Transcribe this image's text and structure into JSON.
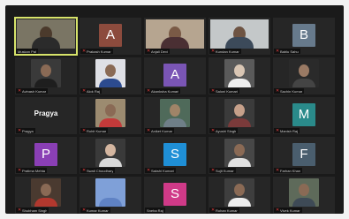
{
  "participants": [
    {
      "name": "Muskan Pal",
      "kind": "video",
      "bg": "#7a7564",
      "skin": "#4b3a2c",
      "shirt": "#2b2b2b",
      "active": true,
      "muted": false
    },
    {
      "name": "Prakash Kumar",
      "kind": "letter",
      "letter": "A",
      "color": "#8c4b3d",
      "muted": true
    },
    {
      "name": "Anjali Devi",
      "kind": "video",
      "bg": "#b6a590",
      "skin": "#7a5a46",
      "shirt": "#4a2f33",
      "active": false,
      "muted": true
    },
    {
      "name": "Kundan Kumar",
      "kind": "video",
      "bg": "#c4c8c9",
      "skin": "#6e5443",
      "shirt": "#3c4a5a",
      "active": false,
      "muted": true
    },
    {
      "name": "Bablu Sahu",
      "kind": "letter",
      "letter": "B",
      "color": "#677a8c",
      "muted": true
    },
    {
      "name": "Avinash Kumar",
      "kind": "photo",
      "bg": "#3a3a3a",
      "skin": "#8a6a55",
      "shirt": "#1e1e1e",
      "muted": true
    },
    {
      "name": "Alok Raj",
      "kind": "photo",
      "bg": "#dfe0e6",
      "skin": "#8a6a55",
      "shirt": "#2c4b8f",
      "muted": true
    },
    {
      "name": "Akanksha Kumari",
      "kind": "letter",
      "letter": "A",
      "color": "#7a55b5",
      "muted": true
    },
    {
      "name": "Saloni Kumari",
      "kind": "photo",
      "bg": "#5a5a5a",
      "skin": "#d9c6b4",
      "shirt": "#efefef",
      "muted": true
    },
    {
      "name": "Sachin Kumar",
      "kind": "photo",
      "bg": "#2a2a2a",
      "skin": "#9a7a64",
      "shirt": "#444444",
      "muted": true
    },
    {
      "name": "Pragya",
      "kind": "name",
      "muted": true
    },
    {
      "name": "Rohit Kumar",
      "kind": "photo",
      "bg": "#9c8b70",
      "skin": "#8a6a55",
      "shirt": "#c33a3a",
      "muted": true
    },
    {
      "name": "Aniket Kumar",
      "kind": "photo",
      "bg": "#4f6a5a",
      "skin": "#a08468",
      "shirt": "#6f7f88",
      "muted": true
    },
    {
      "name": "Ayushi Singh",
      "kind": "photo",
      "bg": "#3b3b3b",
      "skin": "#c6a08a",
      "shirt": "#7a3a3a",
      "muted": true
    },
    {
      "name": "Manish Raj",
      "kind": "letter",
      "letter": "M",
      "color": "#2a8a8a",
      "muted": true
    },
    {
      "name": "Pratima Mehta",
      "kind": "letter",
      "letter": "P",
      "color": "#8a3fb5",
      "muted": true
    },
    {
      "name": "Swati Choudhary",
      "kind": "photo",
      "bg": "#3a3a3a",
      "skin": "#d4b6a0",
      "shirt": "#d9d9d9",
      "muted": true
    },
    {
      "name": "Sakshi Kumari",
      "kind": "letter",
      "letter": "S",
      "color": "#1f8fd6",
      "muted": true
    },
    {
      "name": "Sujit Kumar",
      "kind": "photo",
      "bg": "#474747",
      "skin": "#8a6a55",
      "shirt": "#e0e0e0",
      "muted": true
    },
    {
      "name": "Farhan Khan",
      "kind": "letter",
      "letter": "F",
      "color": "#4a5e6e",
      "muted": true
    },
    {
      "name": "Shubham Singh",
      "kind": "photo",
      "bg": "#4a3a30",
      "skin": "#8a6a55",
      "shirt": "#b2382e",
      "muted": true
    },
    {
      "name": "Kumar Kumar",
      "kind": "photo",
      "bg": "#7fa0d8",
      "skin": "#7fa0d8",
      "shirt": "#5f82c4",
      "muted": true
    },
    {
      "name": "Sneha Raj",
      "kind": "letter",
      "letter": "S",
      "color": "#d03a88",
      "muted": false
    },
    {
      "name": "Rohan Kumar",
      "kind": "photo",
      "bg": "#3e3e3e",
      "skin": "#8a6a55",
      "shirt": "#ededed",
      "muted": true
    },
    {
      "name": "Vivek Kumar",
      "kind": "photo",
      "bg": "#5e6a5a",
      "skin": "#8a6a55",
      "shirt": "#3e4a56",
      "muted": true
    }
  ],
  "icons": {
    "muted_mic": "mic-muted-icon"
  },
  "colors": {
    "frame": "#1a1a1a",
    "active_outline": "#d7e36a",
    "mute_red": "#e23b3b"
  }
}
